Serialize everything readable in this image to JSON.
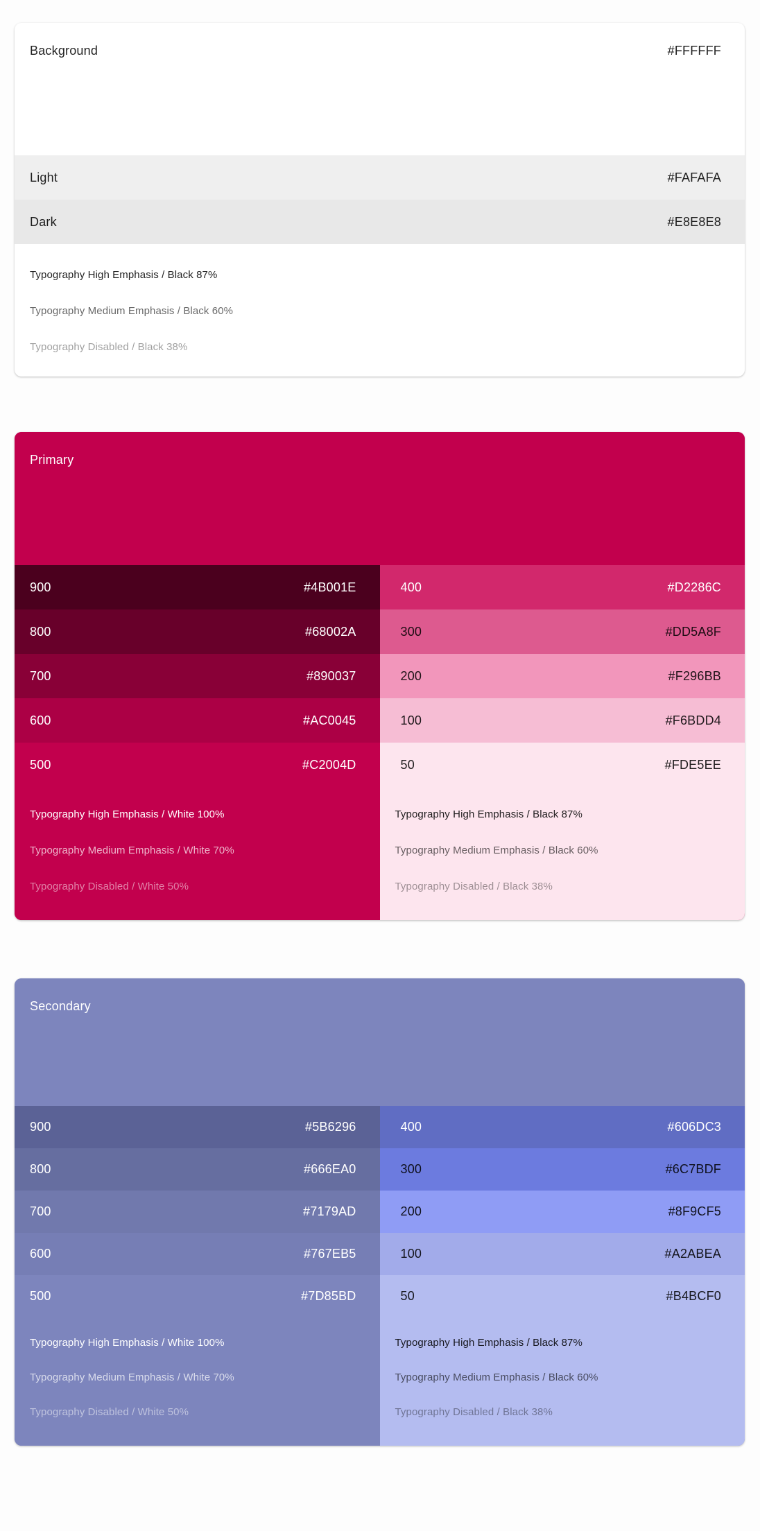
{
  "background": {
    "title": "Background",
    "title_hex": "#FFFFFF",
    "rows": [
      {
        "label": "Light",
        "hex": "#FAFAFA",
        "swatch": "#efefef"
      },
      {
        "label": "Dark",
        "hex": "#E8E8E8",
        "swatch": "#e8e8e8"
      }
    ],
    "typography": [
      "Typography High Emphasis / Black 87%",
      "Typography Medium Emphasis / Black 60%",
      "Typography Disabled / Black 38%"
    ]
  },
  "primary": {
    "title": "Primary",
    "color": "#C2004D",
    "left": [
      {
        "label": "900",
        "hex": "#4B001E"
      },
      {
        "label": "800",
        "hex": "#68002A"
      },
      {
        "label": "700",
        "hex": "#890037"
      },
      {
        "label": "600",
        "hex": "#AC0045"
      },
      {
        "label": "500",
        "hex": "#C2004D"
      }
    ],
    "right": [
      {
        "label": "400",
        "hex": "#D2286C"
      },
      {
        "label": "300",
        "hex": "#DD5A8F"
      },
      {
        "label": "200",
        "hex": "#F296BB"
      },
      {
        "label": "100",
        "hex": "#F6BDD4"
      },
      {
        "label": "50",
        "hex": "#FDE5EE"
      }
    ],
    "typography_white": [
      "Typography High Emphasis / White 100%",
      "Typography Medium Emphasis / White 70%",
      "Typography Disabled / White 50%"
    ],
    "typography_black": [
      "Typography High Emphasis / Black 87%",
      "Typography Medium Emphasis / Black 60%",
      "Typography Disabled / Black 38%"
    ]
  },
  "secondary": {
    "title": "Secondary",
    "color": "#7D85BD",
    "left": [
      {
        "label": "900",
        "hex": "#5B6296"
      },
      {
        "label": "800",
        "hex": "#666EA0"
      },
      {
        "label": "700",
        "hex": "#7179AD"
      },
      {
        "label": "600",
        "hex": "#767EB5"
      },
      {
        "label": "500",
        "hex": "#7D85BD"
      }
    ],
    "right": [
      {
        "label": "400",
        "hex": "#606DC3"
      },
      {
        "label": "300",
        "hex": "#6C7BDF"
      },
      {
        "label": "200",
        "hex": "#8F9CF5"
      },
      {
        "label": "100",
        "hex": "#A2ABEA"
      },
      {
        "label": "50",
        "hex": "#B4BCF0"
      }
    ],
    "typography_white": [
      "Typography High Emphasis / White 100%",
      "Typography Medium Emphasis / White 70%",
      "Typography Disabled / White 50%"
    ],
    "typography_black": [
      "Typography High Emphasis / Black 87%",
      "Typography Medium Emphasis / Black 60%",
      "Typography Disabled / Black 38%"
    ]
  }
}
